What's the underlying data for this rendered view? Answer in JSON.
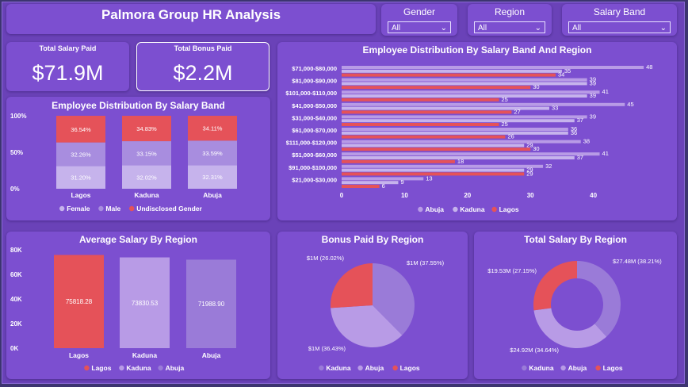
{
  "header": {
    "title": "Palmora Group HR Analysis"
  },
  "slicers": [
    {
      "label": "Gender",
      "value": "All"
    },
    {
      "label": "Region",
      "value": "All"
    },
    {
      "label": "Salary Band",
      "value": "All"
    }
  ],
  "kpis": [
    {
      "label": "Total Salary Paid",
      "value": "$71.9M"
    },
    {
      "label": "Total Bonus Paid",
      "value": "$2.2M"
    }
  ],
  "colors": {
    "lagos": "#e55259",
    "kaduna": "#b89be6",
    "abuja": "#9a7bd8",
    "female": "#c6b3ec",
    "male": "#a88ddf",
    "undisclosed": "#e55259"
  },
  "chart_data": [
    {
      "id": "stacked",
      "type": "bar",
      "title": "Employee Distribution By Salary Band",
      "categories": [
        "Lagos",
        "Kaduna",
        "Abuja"
      ],
      "y_ticks": [
        "100%",
        "50%",
        "0%"
      ],
      "series": [
        {
          "name": "Female",
          "values": [
            31.2,
            32.02,
            32.31
          ],
          "labels": [
            "31.20%",
            "32.02%",
            "32.31%"
          ],
          "color": "#c6b3ec"
        },
        {
          "name": "Male",
          "values": [
            32.26,
            33.15,
            33.59
          ],
          "labels": [
            "32.26%",
            "33.15%",
            "33.59%"
          ],
          "color": "#a88ddf"
        },
        {
          "name": "Undisclosed Gender",
          "values": [
            36.54,
            34.83,
            34.11
          ],
          "labels": [
            "36.54%",
            "34.83%",
            "34.11%"
          ],
          "color": "#e55259"
        }
      ]
    },
    {
      "id": "hbar",
      "type": "bar",
      "title": "Employee Distribution By Salary Band And Region",
      "categories": [
        "$71,000-$80,000",
        "$81,000-$90,000",
        "$101,000-$110,000",
        "$41,000-$50,000",
        "$31,000-$40,000",
        "$61,000-$70,000",
        "$111,000-$120,000",
        "$51,000-$60,000",
        "$91,000-$100,000",
        "$21,000-$30,000"
      ],
      "x_ticks": [
        0,
        10,
        20,
        30,
        40
      ],
      "xlim": [
        0,
        50
      ],
      "series": [
        {
          "name": "Abuja",
          "values": [
            48,
            39,
            41,
            45,
            39,
            36,
            38,
            41,
            32,
            13
          ],
          "color": "#b89be6"
        },
        {
          "name": "Kaduna",
          "values": [
            35,
            39,
            39,
            33,
            37,
            36,
            29,
            37,
            29,
            9
          ],
          "color": "#c6b3ec"
        },
        {
          "name": "Lagos",
          "values": [
            34,
            30,
            25,
            27,
            25,
            26,
            30,
            18,
            29,
            6
          ],
          "color": "#e55259"
        }
      ]
    },
    {
      "id": "avgsalary",
      "type": "bar",
      "title": "Average Salary By Region",
      "categories": [
        "Lagos",
        "Kaduna",
        "Abuja"
      ],
      "values": [
        75818.28,
        73830.53,
        71988.9
      ],
      "value_labels": [
        "75818.28",
        "73830.53",
        "71988.90"
      ],
      "colors": [
        "#e55259",
        "#b89be6",
        "#9a7bd8"
      ],
      "y_ticks": [
        "80K",
        "60K",
        "40K",
        "20K",
        "0K"
      ],
      "ylim": [
        0,
        80000
      ],
      "legend": [
        "Lagos",
        "Kaduna",
        "Abuja"
      ]
    },
    {
      "id": "bonuspie",
      "type": "pie",
      "title": "Bonus Paid By Region",
      "slices": [
        {
          "name": "Kaduna",
          "value": 37.55,
          "label": "$1M (37.55%)",
          "color": "#9a7bd8"
        },
        {
          "name": "Abuja",
          "value": 36.43,
          "label": "$1M (36.43%)",
          "color": "#b89be6"
        },
        {
          "name": "Lagos",
          "value": 26.02,
          "label": "$1M (26.02%)",
          "color": "#e55259"
        }
      ],
      "legend": [
        "Kaduna",
        "Abuja",
        "Lagos"
      ]
    },
    {
      "id": "salarydonut",
      "type": "pie",
      "title": "Total Salary By Region",
      "slices": [
        {
          "name": "Kaduna",
          "value": 38.21,
          "label": "$27.48M (38.21%)",
          "color": "#9a7bd8"
        },
        {
          "name": "Abuja",
          "value": 34.64,
          "label": "$24.92M (34.64%)",
          "color": "#b89be6"
        },
        {
          "name": "Lagos",
          "value": 27.15,
          "label": "$19.53M (27.15%)",
          "color": "#e55259"
        }
      ],
      "legend": [
        "Kaduna",
        "Abuja",
        "Lagos"
      ]
    }
  ]
}
